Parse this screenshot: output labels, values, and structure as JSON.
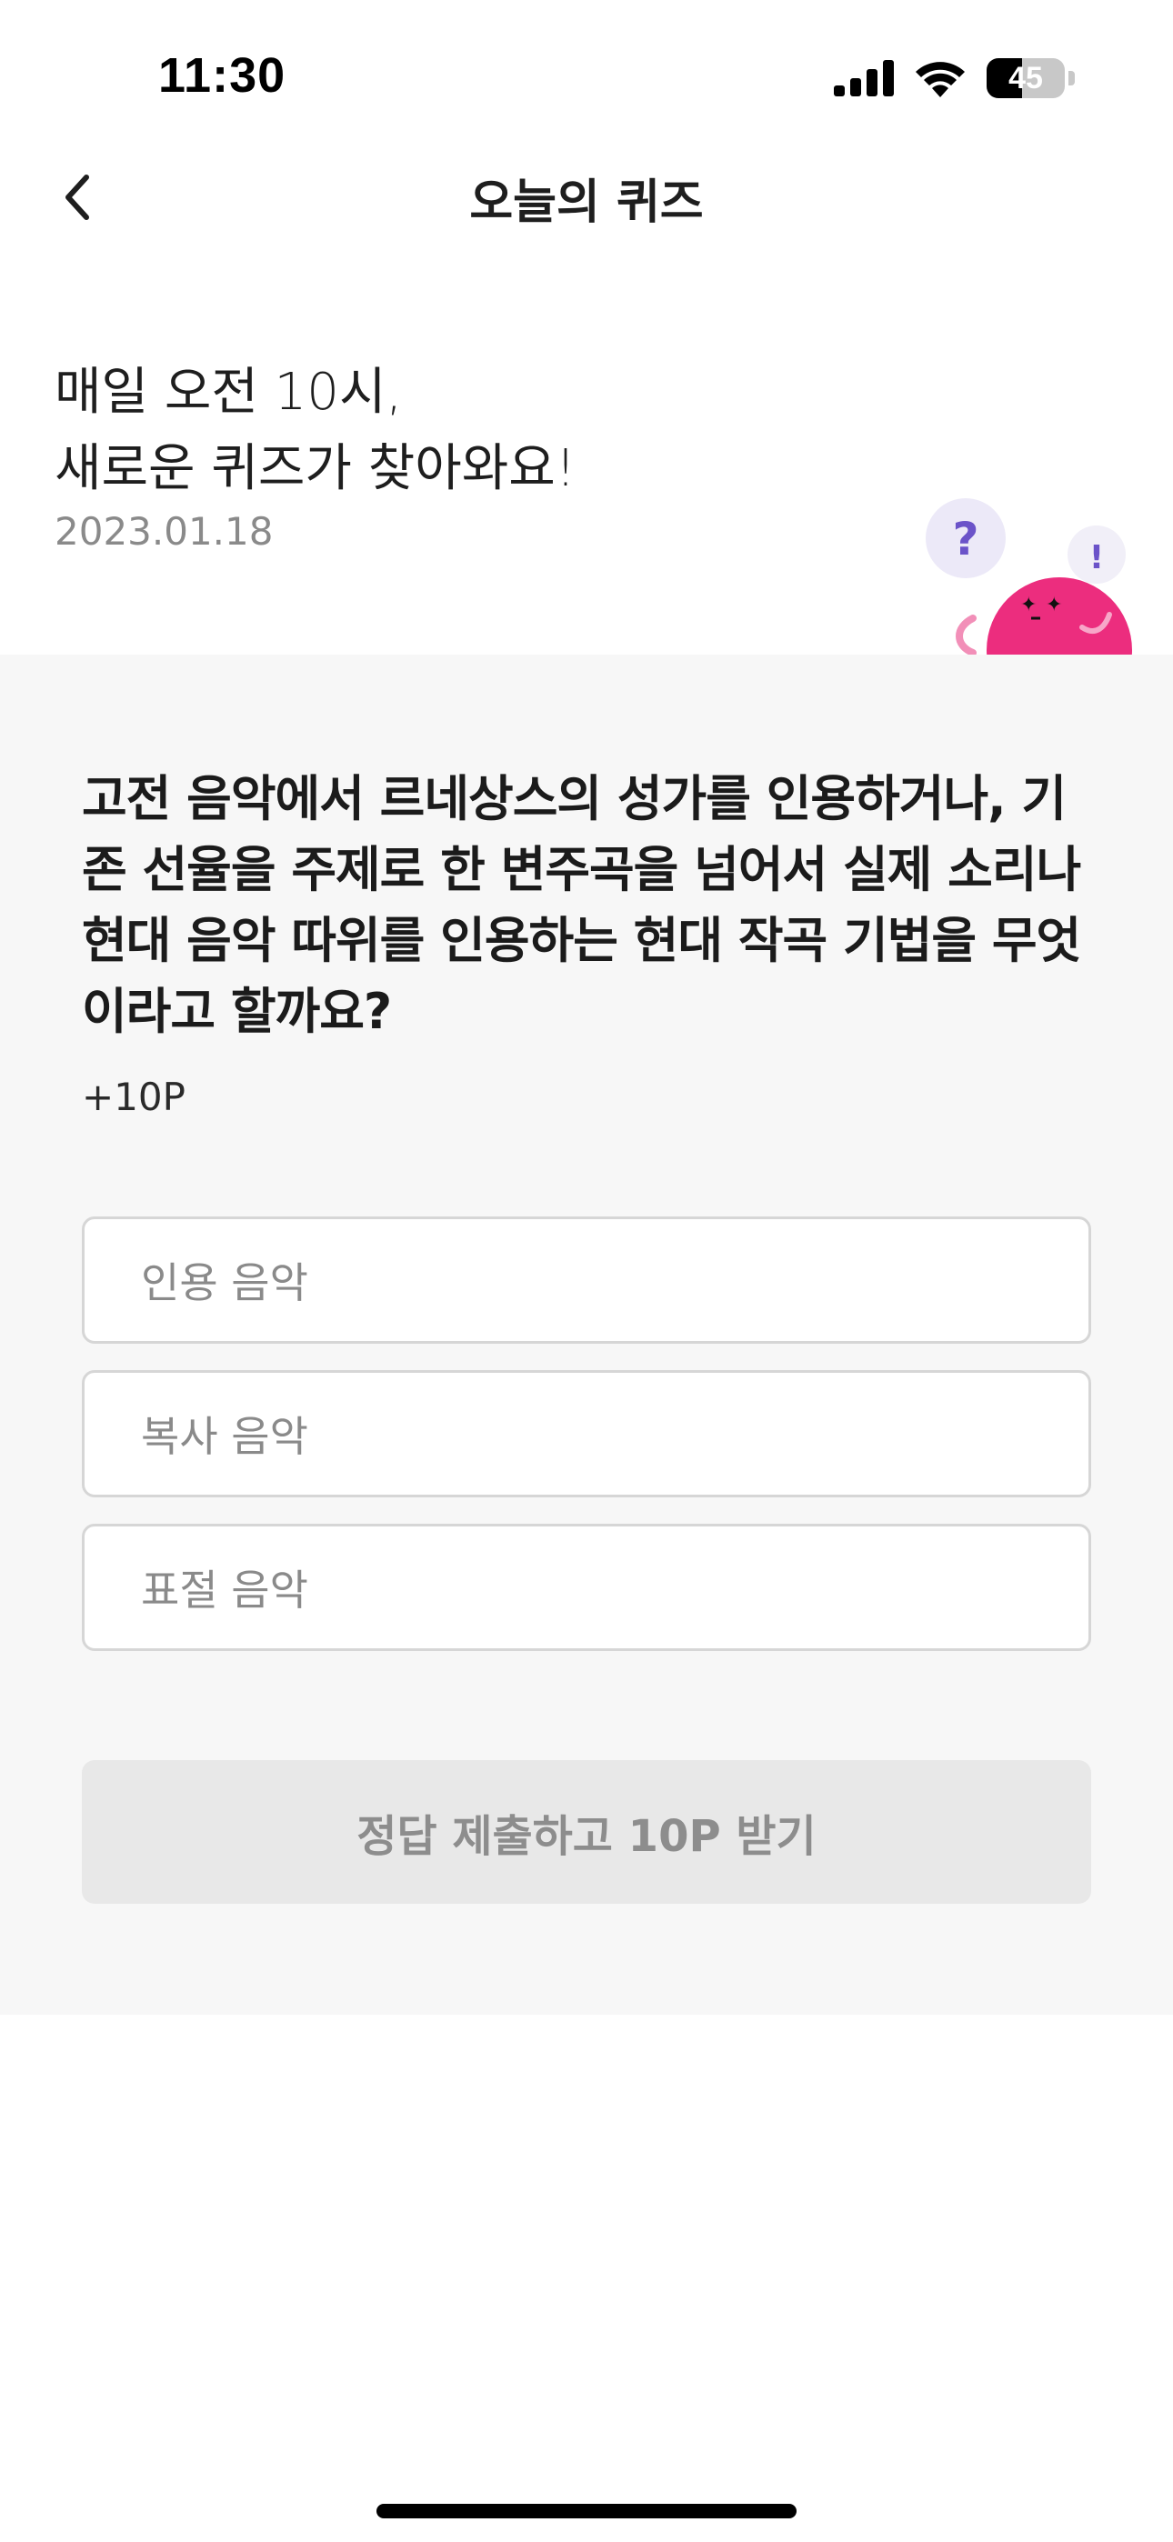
{
  "status_bar": {
    "time": "11:30",
    "battery_text": "45",
    "battery_level_percent": 45,
    "icons": [
      "cellular-signal-icon",
      "wifi-icon",
      "battery-icon"
    ]
  },
  "nav": {
    "back_icon": "chevron-left-icon",
    "title": "오늘의 퀴즈"
  },
  "intro": {
    "line1": "매일 오전 10시,",
    "line2": "새로운 퀴즈가 찾아와요!",
    "date": "2023.01.18"
  },
  "mascot": {
    "icon": "quiz-mascot-icon",
    "question_mark": "?",
    "exclamation_mark": "!",
    "colors": {
      "body": "#ec2d7e",
      "bubble": "#ece9f8",
      "accent": "#6b53c9"
    }
  },
  "quiz": {
    "question": "고전 음악에서 르네상스의 성가를 인용하거나, 기존 선율을 주제로 한 변주곡을 넘어서 실제 소리나 현대 음악 따위를 인용하는 현대 작곡 기법을 무엇이라고 할까요?",
    "points": "+10P",
    "options": [
      {
        "label": "인용 음악"
      },
      {
        "label": "복사 음악"
      },
      {
        "label": "표절 음악"
      }
    ],
    "submit_label": "정답 제출하고 10P 받기"
  },
  "colors": {
    "panel_background": "#f7f7f7",
    "option_border": "#d6d6d6",
    "submit_disabled_bg": "#e8e8e8",
    "submit_disabled_text": "#8d8d8d"
  }
}
